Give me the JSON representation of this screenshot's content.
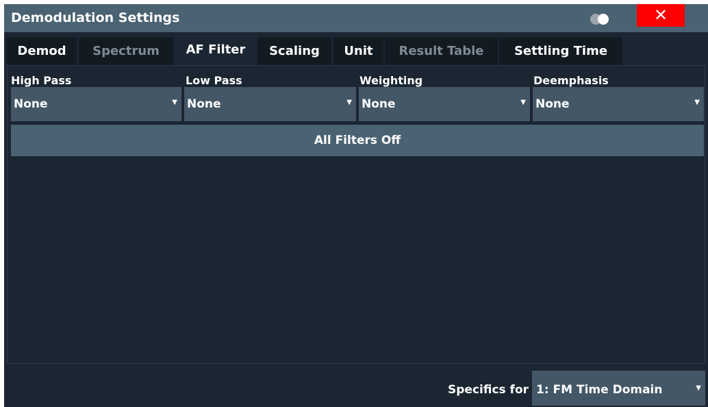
{
  "dialog": {
    "title": "Demodulation Settings",
    "close_label": "✕"
  },
  "tabs": [
    {
      "label": "Demod",
      "state": "normal"
    },
    {
      "label": "Spectrum",
      "state": "disabled"
    },
    {
      "label": "AF Filter",
      "state": "active"
    },
    {
      "label": "Scaling",
      "state": "normal"
    },
    {
      "label": "Unit",
      "state": "normal"
    },
    {
      "label": "Result Table",
      "state": "disabled"
    },
    {
      "label": "Settling Time",
      "state": "normal"
    }
  ],
  "filters": {
    "high_pass": {
      "label": "High Pass",
      "value": "None"
    },
    "low_pass": {
      "label": "Low Pass",
      "value": "None"
    },
    "weighting": {
      "label": "Weighting",
      "value": "None"
    },
    "deemphasis": {
      "label": "Deemphasis",
      "value": "None"
    },
    "all_off_label": "All Filters Off"
  },
  "footer": {
    "specifics_label": "Specifics for",
    "specifics_value": "1: FM Time Domain"
  },
  "icons": {
    "toggle": "toggle-icon",
    "close": "close-icon",
    "dropdown_arrow": "dropdown-arrow-icon"
  },
  "colors": {
    "title_bar": "#4a6272",
    "dialog_bg": "#1b2632",
    "close_button": "#ff0000",
    "dropdown_bg": "#445767",
    "disabled_text": "#7f8a93"
  }
}
